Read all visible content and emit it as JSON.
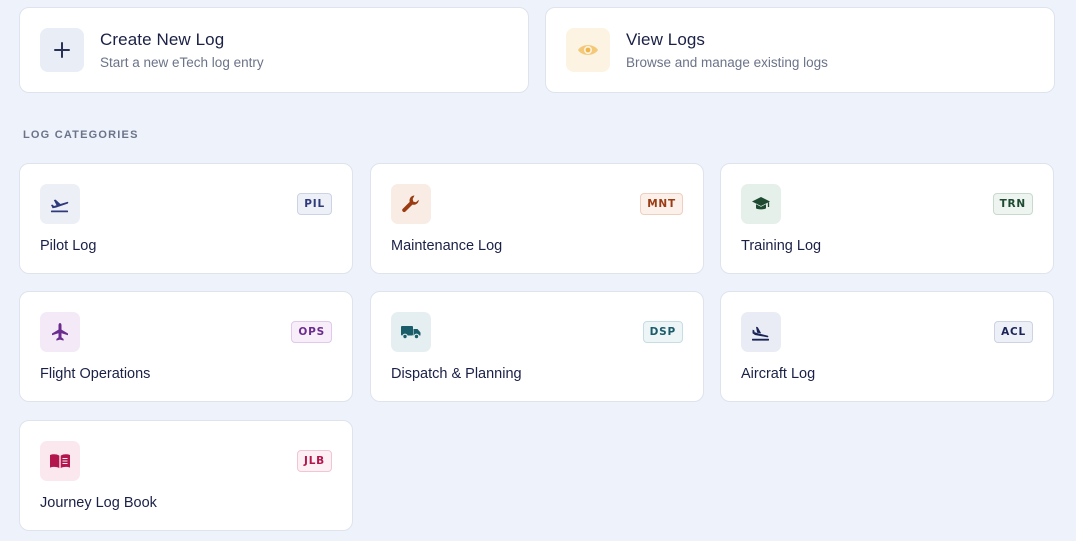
{
  "actions": {
    "create": {
      "title": "Create New Log",
      "subtitle": "Start a new eTech log entry",
      "icon": "plus-icon"
    },
    "view": {
      "title": "View Logs",
      "subtitle": "Browse and manage existing logs",
      "icon": "eye-icon"
    }
  },
  "section": {
    "label": "LOG CATEGORIES"
  },
  "categories": [
    {
      "name": "Pilot Log",
      "code": "PIL",
      "icon": "plane-takeoff-icon"
    },
    {
      "name": "Maintenance Log",
      "code": "MNT",
      "icon": "wrench-icon"
    },
    {
      "name": "Training Log",
      "code": "TRN",
      "icon": "graduation-cap-icon"
    },
    {
      "name": "Flight Operations",
      "code": "OPS",
      "icon": "airplane-icon"
    },
    {
      "name": "Dispatch & Planning",
      "code": "DSP",
      "icon": "truck-icon"
    },
    {
      "name": "Aircraft Log",
      "code": "ACL",
      "icon": "plane-landing-icon"
    },
    {
      "name": "Journey Log Book",
      "code": "JLB",
      "icon": "book-icon"
    }
  ],
  "colors": {
    "background": "#eef2fb",
    "pil": "#2e3a7c",
    "mnt": "#9a3b12",
    "trn": "#1d4a30",
    "ops": "#6b2c8f",
    "dsp": "#1b5c6a",
    "acl": "#1b2458",
    "jlb": "#b3164d",
    "view_accent": "#f0b54a"
  }
}
